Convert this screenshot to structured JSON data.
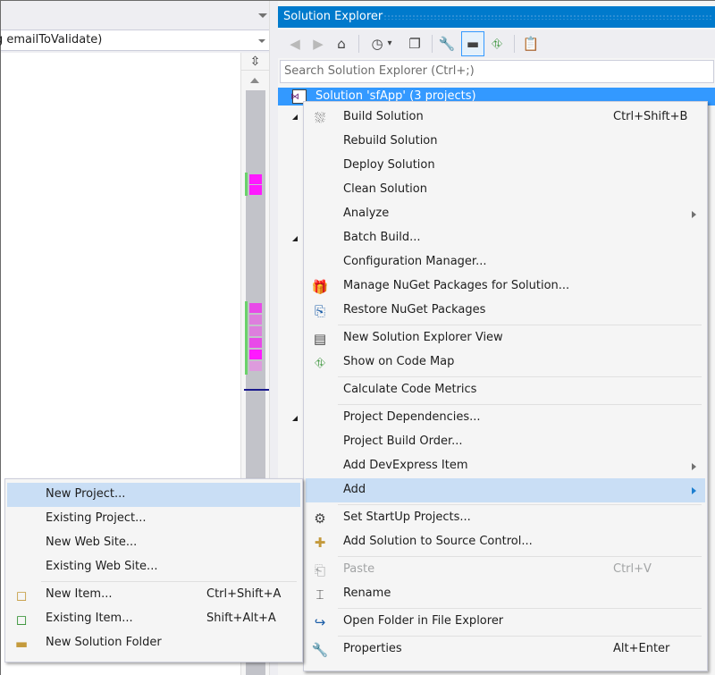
{
  "editor": {
    "member_combo_text": "g emailToValidate)",
    "split_icon": "⇳"
  },
  "solution_explorer": {
    "title": "Solution Explorer",
    "search_placeholder": "Search Solution Explorer (Ctrl+;)",
    "toolbar": [
      {
        "name": "back-icon",
        "glyph": "◀",
        "disabled": true
      },
      {
        "name": "forward-icon",
        "glyph": "▶",
        "disabled": true
      },
      {
        "name": "home-icon",
        "glyph": "⌂"
      },
      {
        "name": "pending-changes-filter-icon",
        "glyph": "◷"
      },
      {
        "name": "dropdown-icon",
        "glyph": "▾"
      },
      {
        "name": "collapse-all-icon",
        "glyph": "❐"
      },
      {
        "name": "properties-wrench-icon",
        "glyph": "🔧"
      },
      {
        "name": "preview-selected-items-icon",
        "glyph": "▬",
        "active": true
      },
      {
        "name": "code-map-icon",
        "glyph": "⛗"
      },
      {
        "name": "view-class-diagram-icon",
        "glyph": "📋"
      }
    ],
    "tree_root_label": "Solution 'sfApp' (3 projects)"
  },
  "context_menu": {
    "items": [
      {
        "label": "Build Solution",
        "shortcut": "Ctrl+Shift+B",
        "icon": "build-icon",
        "glyph": "⛆"
      },
      {
        "label": "Rebuild Solution"
      },
      {
        "label": "Deploy Solution"
      },
      {
        "label": "Clean Solution"
      },
      {
        "label": "Analyze",
        "submenu": true
      },
      {
        "label": "Batch Build..."
      },
      {
        "label": "Configuration Manager..."
      },
      {
        "label": "Manage NuGet Packages for Solution...",
        "icon": "nuget-package-icon",
        "glyph": "🎁"
      },
      {
        "label": "Restore NuGet Packages",
        "icon": "restore-packages-icon",
        "glyph": "⎘"
      },
      {
        "label": "New Solution Explorer View",
        "icon": "new-view-icon",
        "glyph": "▤"
      },
      {
        "label": "Show on Code Map",
        "icon": "code-map-icon",
        "glyph": "⛗"
      },
      {
        "label": "Calculate Code Metrics"
      },
      {
        "label": "Project Dependencies..."
      },
      {
        "label": "Project Build Order..."
      },
      {
        "label": "Add DevExpress Item",
        "submenu": true
      },
      {
        "label": "Add",
        "submenu": true,
        "highlighted": true
      },
      {
        "label": "Set StartUp Projects...",
        "icon": "gear-icon",
        "glyph": "⚙"
      },
      {
        "label": "Add Solution to Source Control...",
        "icon": "source-control-icon",
        "glyph": "✚"
      },
      {
        "label": "Paste",
        "shortcut": "Ctrl+V",
        "icon": "paste-icon",
        "glyph": "⎗",
        "disabled": true
      },
      {
        "label": "Rename",
        "icon": "rename-icon",
        "glyph": "⌶"
      },
      {
        "label": "Open Folder in File Explorer",
        "icon": "open-folder-icon",
        "glyph": "↪"
      },
      {
        "label": "Properties",
        "shortcut": "Alt+Enter",
        "icon": "wrench-icon",
        "glyph": "🔧"
      }
    ]
  },
  "add_submenu": {
    "items": [
      {
        "label": "New Project...",
        "highlighted": true
      },
      {
        "label": "Existing Project..."
      },
      {
        "label": "New Web Site..."
      },
      {
        "label": "Existing Web Site..."
      },
      {
        "label": "New Item...",
        "shortcut": "Ctrl+Shift+A",
        "icon": "new-item-icon",
        "glyph": "◻"
      },
      {
        "label": "Existing Item...",
        "shortcut": "Shift+Alt+A",
        "icon": "existing-item-icon",
        "glyph": "◻"
      },
      {
        "label": "New Solution Folder",
        "icon": "new-folder-icon",
        "glyph": "▬"
      }
    ]
  },
  "colors": {
    "accent": "#007acc",
    "selection": "#3399ff",
    "menu_highlight": "#c9def5",
    "change_marker": "#ff00ff",
    "added_marker": "#6ad26a"
  }
}
